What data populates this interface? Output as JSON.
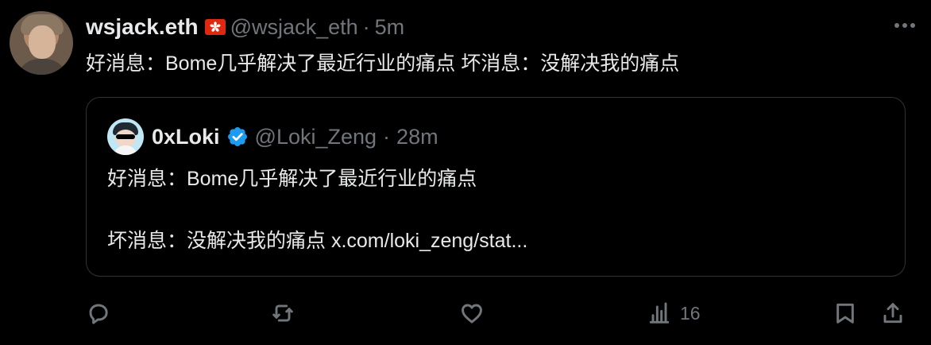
{
  "author": {
    "display_name": "wsjack.eth",
    "handle": "@wsjack_eth",
    "separator": "·",
    "time": "5m",
    "flag_emoji": "hong-kong-flag-icon"
  },
  "tweet": {
    "text": "好消息：Bome几乎解决了最近行业的痛点  坏消息：没解决我的痛点"
  },
  "quote": {
    "display_name": "0xLoki",
    "verified_icon": "verified-badge-icon",
    "handle": "@Loki_Zeng",
    "separator": "·",
    "time": "28m",
    "line1": "好消息：Bome几乎解决了最近行业的痛点",
    "line2_prefix": "坏消息：没解决我的痛点 ",
    "line2_link": "x.com/loki_zeng/stat..."
  },
  "actions": {
    "reply_icon": "reply-icon",
    "retweet_icon": "retweet-icon",
    "like_icon": "like-heart-icon",
    "views_icon": "views-chart-icon",
    "views_count": "16",
    "bookmark_icon": "bookmark-icon",
    "share_icon": "share-icon"
  },
  "colors": {
    "background": "#000000",
    "text_primary": "#e7e9ea",
    "text_secondary": "#71767b",
    "border": "#2f3336",
    "verified": "#1d9bf0",
    "flag": "#de2910"
  }
}
